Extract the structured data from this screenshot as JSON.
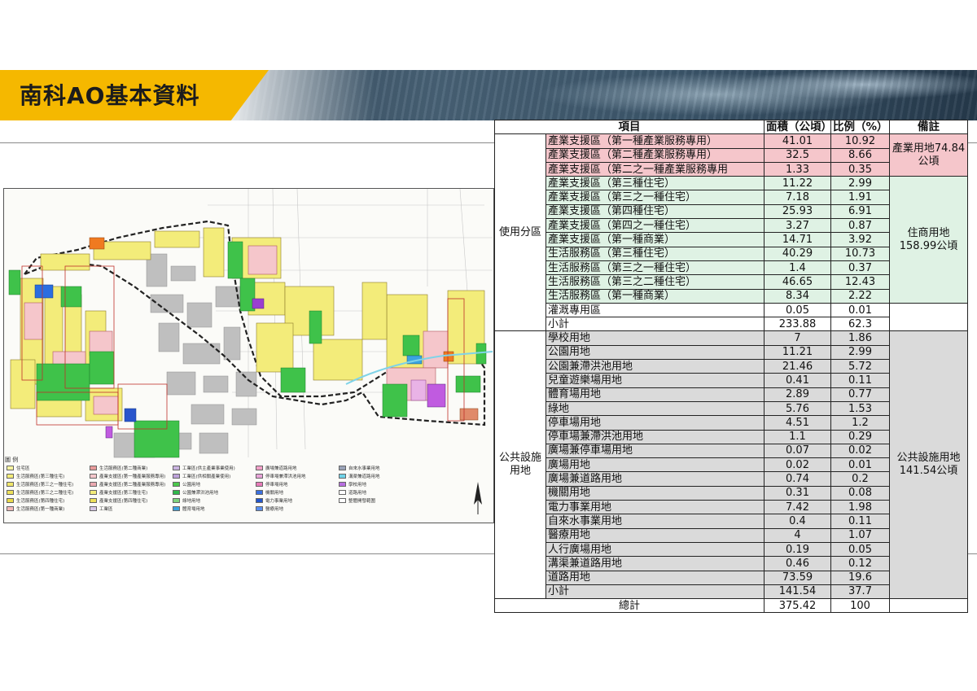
{
  "title": "南科AO基本資料",
  "table": {
    "headers": [
      "項目",
      "面積（公頃）",
      "比例（%）",
      "備註"
    ],
    "zoning_category": "使用分區",
    "zoning_rows": [
      {
        "item": "產業支援區（第一種產業服務專用）",
        "area": "41.01",
        "ratio": "10.92"
      },
      {
        "item": "產業支援區（第二種產業服務專用）",
        "area": "32.5",
        "ratio": "8.66"
      },
      {
        "item": "產業支援區（第二之一種產業服務專用",
        "area": "1.33",
        "ratio": "0.35"
      },
      {
        "item": "產業支援區（第三種住宅）",
        "area": "11.22",
        "ratio": "2.99"
      },
      {
        "item": "產業支援區（第三之一種住宅）",
        "area": "7.18",
        "ratio": "1.91"
      },
      {
        "item": "產業支援區（第四種住宅）",
        "area": "25.93",
        "ratio": "6.91"
      },
      {
        "item": "產業支援區（第四之一種住宅）",
        "area": "3.27",
        "ratio": "0.87"
      },
      {
        "item": "產業支援區（第一種商業）",
        "area": "14.71",
        "ratio": "3.92"
      },
      {
        "item": "生活服務區（第三種住宅）",
        "area": "40.29",
        "ratio": "10.73"
      },
      {
        "item": "生活服務區（第三之一種住宅）",
        "area": "1.4",
        "ratio": "0.37"
      },
      {
        "item": "生活服務區（第三之二種住宅）",
        "area": "46.65",
        "ratio": "12.43"
      },
      {
        "item": "生活服務區（第一種商業）",
        "area": "8.34",
        "ratio": "2.22"
      },
      {
        "item": "灌溉專用區",
        "area": "0.05",
        "ratio": "0.01"
      },
      {
        "item": "小計",
        "area": "233.88",
        "ratio": "62.3"
      }
    ],
    "note_industry": "產業用地74.84公頃",
    "note_residential": "住商用地158.99公頃",
    "public_category": "公共設施用地",
    "public_rows": [
      {
        "item": "學校用地",
        "area": "7",
        "ratio": "1.86"
      },
      {
        "item": "公園用地",
        "area": "11.21",
        "ratio": "2.99"
      },
      {
        "item": "公園兼滯洪池用地",
        "area": "21.46",
        "ratio": "5.72"
      },
      {
        "item": "兒童遊樂場用地",
        "area": "0.41",
        "ratio": "0.11"
      },
      {
        "item": "體育場用地",
        "area": "2.89",
        "ratio": "0.77"
      },
      {
        "item": "綠地",
        "area": "5.76",
        "ratio": "1.53"
      },
      {
        "item": "停車場用地",
        "area": "4.51",
        "ratio": "1.2"
      },
      {
        "item": "停車場兼滯洪池用地",
        "area": "1.1",
        "ratio": "0.29"
      },
      {
        "item": "廣場兼停車場用地",
        "area": "0.07",
        "ratio": "0.02"
      },
      {
        "item": "廣場用地",
        "area": "0.02",
        "ratio": "0.01"
      },
      {
        "item": "廣場兼道路用地",
        "area": "0.74",
        "ratio": "0.2"
      },
      {
        "item": "機關用地",
        "area": "0.31",
        "ratio": "0.08"
      },
      {
        "item": "電力事業用地",
        "area": "7.42",
        "ratio": "1.98"
      },
      {
        "item": "自來水事業用地",
        "area": "0.4",
        "ratio": "0.11"
      },
      {
        "item": "醫療用地",
        "area": "4",
        "ratio": "1.07"
      },
      {
        "item": "人行廣場用地",
        "area": "0.19",
        "ratio": "0.05"
      },
      {
        "item": "溝渠兼道路用地",
        "area": "0.46",
        "ratio": "0.12"
      },
      {
        "item": "道路用地",
        "area": "73.59",
        "ratio": "19.6"
      },
      {
        "item": "小計",
        "area": "141.54",
        "ratio": "37.7"
      }
    ],
    "note_public": "公共設施用地141.54公頃",
    "total": {
      "label": "總計",
      "area": "375.42",
      "ratio": "100"
    }
  },
  "map": {
    "legend_title": "圖 例",
    "legend": [
      {
        "label": "住宅區",
        "color": "#f6f3a0"
      },
      {
        "label": "生活服務區(第三種住宅)",
        "color": "#f3ec7a"
      },
      {
        "label": "生活服務區(第三之一種住宅)",
        "color": "#f0e66a"
      },
      {
        "label": "生活服務區(第三之二種住宅)",
        "color": "#ede05a"
      },
      {
        "label": "生活服務區(第四種住宅)",
        "color": "#e9da4a"
      },
      {
        "label": "生活服務區(第一種商業)",
        "color": "#f2b8b8"
      },
      {
        "label": "生活服務區(第二種商業)",
        "color": "#e89a9a"
      },
      {
        "label": "產業支援區(第一種產業服務專用)",
        "color": "#f5c6cb"
      },
      {
        "label": "產業支援區(第二種產業服務專用)",
        "color": "#eaa9b0"
      },
      {
        "label": "產業支援區(第三種住宅)",
        "color": "#f3ec7a"
      },
      {
        "label": "產業支援區(第四種住宅)",
        "color": "#ede05a"
      },
      {
        "label": "工業區",
        "color": "#d6c6e6"
      },
      {
        "label": "工業區(供主產業事業使用)",
        "color": "#c9b3e0"
      },
      {
        "label": "工業區(供相關產業使用)",
        "color": "#bda2da"
      },
      {
        "label": "公園用地",
        "color": "#4cc94c"
      },
      {
        "label": "公園兼滯洪池用地",
        "color": "#2fb84a"
      },
      {
        "label": "綠地用地",
        "color": "#7ed37e"
      },
      {
        "label": "體育場用地",
        "color": "#3aa3e0"
      },
      {
        "label": "廣場兼道路用地",
        "color": "#f2a0c8"
      },
      {
        "label": "停車場兼滯洪池用地",
        "color": "#e7a3d8"
      },
      {
        "label": "停車場用地",
        "color": "#e77bb8"
      },
      {
        "label": "機關用地",
        "color": "#3a6fe0"
      },
      {
        "label": "電力事業用地",
        "color": "#2255cc"
      },
      {
        "label": "醫療用地",
        "color": "#5a8ff0"
      },
      {
        "label": "自來水事業用地",
        "color": "#9aa3b8"
      },
      {
        "label": "溝渠兼道路用地",
        "color": "#6fd3e8"
      },
      {
        "label": "學校用地",
        "color": "#b86fe0"
      },
      {
        "label": "道路用地",
        "color": "#ffffff"
      },
      {
        "label": "整體開發範圍",
        "color": "#ffffff"
      }
    ]
  }
}
